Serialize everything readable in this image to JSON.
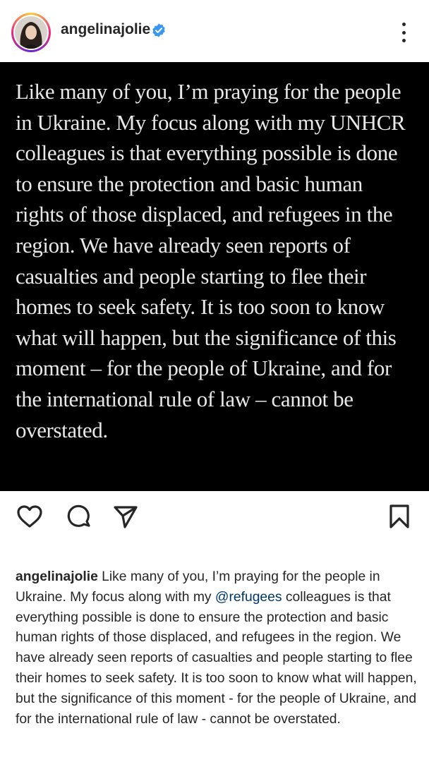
{
  "post": {
    "username": "angelinajolie",
    "image_text": "Like many of you, I’m praying for the people in Ukraine. My focus along with my UNHCR colleagues is that everything possible is done to ensure the protection and basic human rights of those displaced, and refugees in the region. We have already seen reports of casualties and people starting to flee their homes to seek safety. It is too soon to know what will happen, but the significance of this moment – for the people of Ukraine, and for the international rule of law – cannot be overstated."
  },
  "caption": {
    "username": "angelinajolie",
    "text_before": " Like many of you, I’m praying for the people in Ukraine. My focus along with my ",
    "mention": "@refugees",
    "text_after": " colleagues is that everything possible is done to ensure the protection and basic human rights of those displaced, and refugees in the region. We have already seen reports of casualties and people starting to flee their homes to seek safety. It is too soon to know what will happen, but the significance of this moment - for the people of Ukraine, and for the international rule of law - cannot be overstated."
  },
  "icons": {
    "verified": "verified-badge-icon",
    "more": "more-options-icon",
    "like": "heart-icon",
    "comment": "comment-icon",
    "share": "send-icon",
    "save": "bookmark-icon"
  },
  "colors": {
    "verified_blue": "#3897f0",
    "mention": "#00376b",
    "post_background": "#000000"
  }
}
